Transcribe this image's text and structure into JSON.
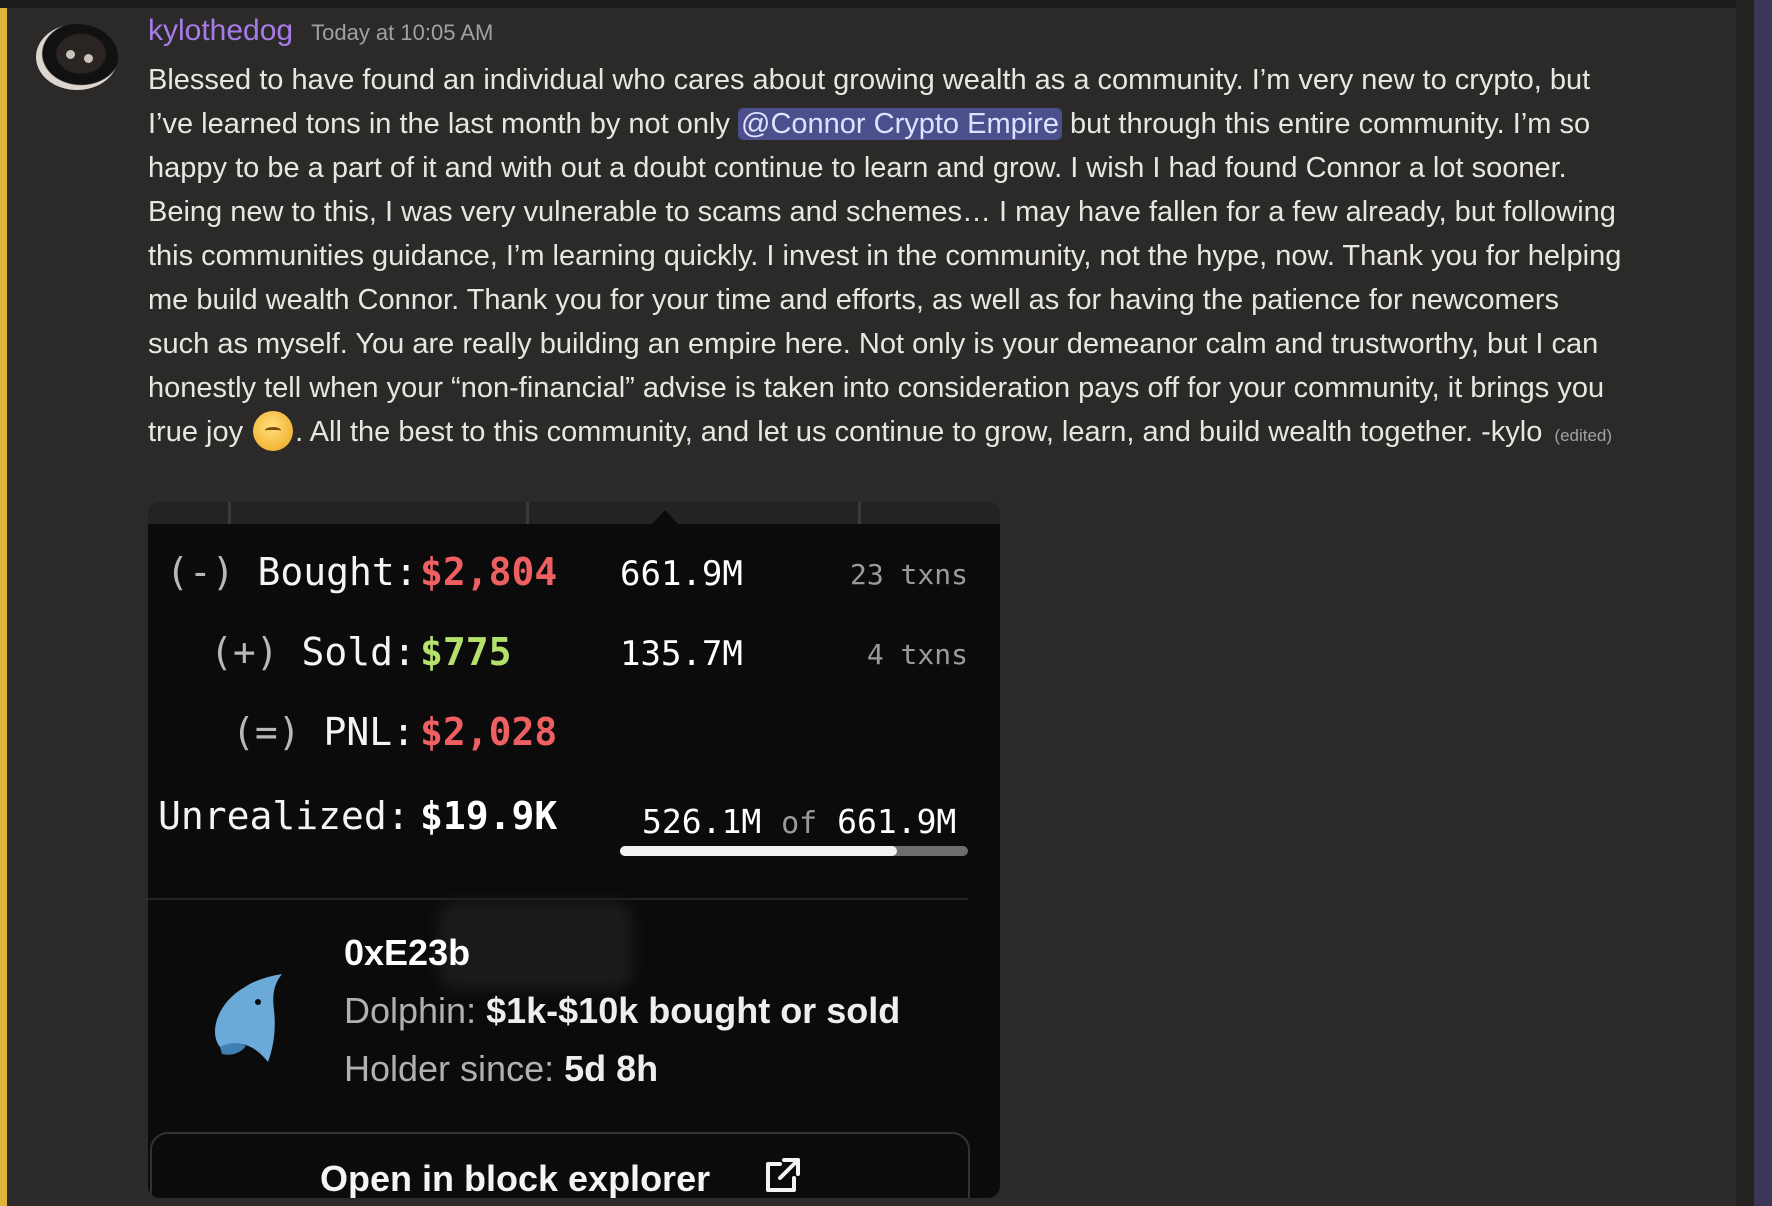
{
  "message": {
    "username": "kylothedog",
    "timestamp": "Today at 10:05 AM",
    "text_part1": "Blessed to have found an individual who cares about growing wealth as a community. I’m very new to crypto, but I’ve learned tons in the last month by not only ",
    "mention": "@Connor Crypto Empire",
    "text_part2": " but through this entire community. I’m so happy to be a part of it and with out a doubt continue to learn and grow.  I wish I had found Connor a lot sooner. Being new to this, I was very vulnerable to scams and schemes… I may have fallen for a few already, but following this communities guidance, I’m learning quickly. I invest in the community, not the hype, now. Thank you for helping me build wealth Connor. Thank you for your time and efforts, as well as for having the patience for newcomers such as myself. You are really building an empire here. Not only is your demeanor calm and trustworthy, but I can honestly tell when your “non-financial” advise is taken into consideration pays off for your community, it brings you true joy ",
    "emoji": "saluting-face-icon",
    "text_part3": ". All the best to this community, and let us continue to grow, learn, and build wealth together. -kylo",
    "edited": "(edited)"
  },
  "embed": {
    "bought": {
      "paren": "(-)",
      "label": "Bought:",
      "value": "$2,804",
      "amount": "661.9M",
      "txns": "23 txns"
    },
    "sold": {
      "paren": "(+)",
      "label": "Sold:",
      "value": "$775",
      "amount": "135.7M",
      "txns": "4 txns"
    },
    "pnl": {
      "paren": "(=)",
      "label": "PNL:",
      "value": "$2,028"
    },
    "unrealized": {
      "label": "Unrealized:",
      "value": "$19.9K",
      "held": "526.1M",
      "of": "of",
      "total": "661.9M",
      "progress": 0.795
    },
    "wallet": {
      "address": "0xE23b",
      "icon": "dolphin-icon",
      "tier_label": "Dolphin:",
      "tier_value": "$1k-$10k bought or sold",
      "holder_label": "Holder since:",
      "holder_value": "5d 8h"
    },
    "button_label": "Open in block explorer",
    "button_icon": "external-link-icon"
  },
  "colors": {
    "username": "#a77be8",
    "mention_bg": "#4b4f8c",
    "negative": "#ee5f62",
    "positive": "#b4e06b",
    "accent_bar": "#e0b33a"
  }
}
